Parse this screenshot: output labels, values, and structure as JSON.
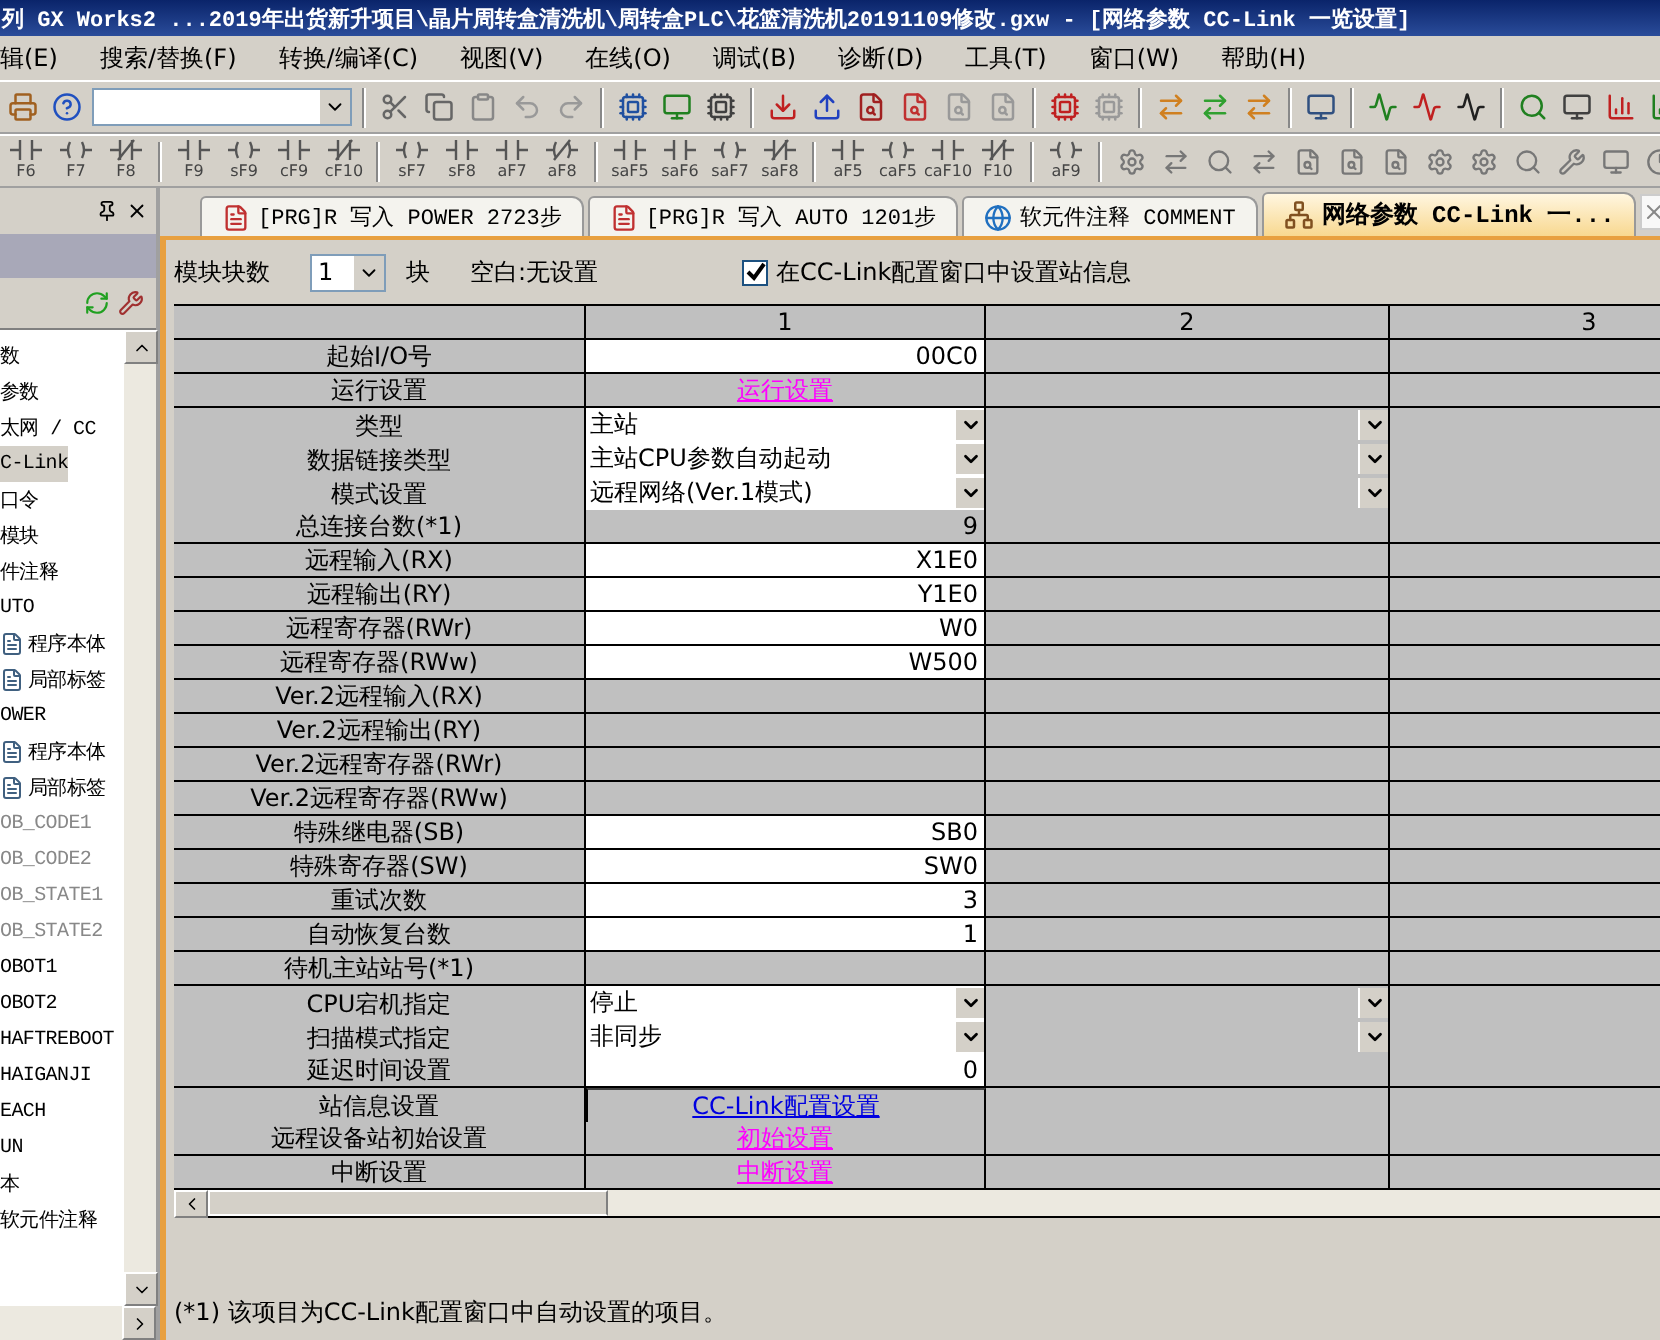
{
  "window": {
    "title": "列 GX Works2 ...2019年出货新升项目\\晶片周转盒清洗机\\周转盒PLC\\花篮清洗机20191109修改.gxw - [网络参数  CC-Link 一览设置]"
  },
  "menu": [
    "辑(E)",
    "搜索/替换(F)",
    "转换/编译(C)",
    "视图(V)",
    "在线(O)",
    "调试(B)",
    "诊断(D)",
    "工具(T)",
    "窗口(W)",
    "帮助(H)"
  ],
  "function_keys": [
    "F6",
    "F7",
    "F8",
    "F9",
    "sF9",
    "cF9",
    "cF10",
    "sF7",
    "sF8",
    "aF7",
    "aF8",
    "saF5",
    "saF6",
    "saF7",
    "saF8",
    "aF5",
    "caF5",
    "caF10",
    "F10",
    "aF9"
  ],
  "sidebar": {
    "items": [
      {
        "label": "数",
        "kind": "text",
        "selected": false,
        "dimmed": false
      },
      {
        "label": "参数",
        "kind": "text",
        "selected": false,
        "dimmed": false
      },
      {
        "label": "太网 / CC",
        "kind": "text",
        "selected": false,
        "dimmed": false
      },
      {
        "label": "C-Link",
        "kind": "text",
        "selected": true,
        "dimmed": false
      },
      {
        "label": "口令",
        "kind": "text",
        "selected": false,
        "dimmed": false
      },
      {
        "label": "模块",
        "kind": "text",
        "selected": false,
        "dimmed": false
      },
      {
        "label": "件注释",
        "kind": "text",
        "selected": false,
        "dimmed": false
      },
      {
        "label": "UTO",
        "kind": "text",
        "selected": false,
        "dimmed": false
      },
      {
        "label": "程序本体",
        "kind": "file",
        "selected": false,
        "dimmed": false
      },
      {
        "label": "局部标签",
        "kind": "file",
        "selected": false,
        "dimmed": false
      },
      {
        "label": "OWER",
        "kind": "text",
        "selected": false,
        "dimmed": false
      },
      {
        "label": "程序本体",
        "kind": "file",
        "selected": false,
        "dimmed": false
      },
      {
        "label": "局部标签",
        "kind": "file",
        "selected": false,
        "dimmed": false
      },
      {
        "label": "OB_CODE1",
        "kind": "text",
        "selected": false,
        "dimmed": true
      },
      {
        "label": "OB_CODE2",
        "kind": "text",
        "selected": false,
        "dimmed": true
      },
      {
        "label": "OB_STATE1",
        "kind": "text",
        "selected": false,
        "dimmed": true
      },
      {
        "label": "OB_STATE2",
        "kind": "text",
        "selected": false,
        "dimmed": true
      },
      {
        "label": "OBOT1",
        "kind": "text",
        "selected": false,
        "dimmed": false
      },
      {
        "label": "OBOT2",
        "kind": "text",
        "selected": false,
        "dimmed": false
      },
      {
        "label": "HAFTREBOOT",
        "kind": "text",
        "selected": false,
        "dimmed": false
      },
      {
        "label": "HAIGANJI",
        "kind": "text",
        "selected": false,
        "dimmed": false
      },
      {
        "label": "EACH",
        "kind": "text",
        "selected": false,
        "dimmed": false
      },
      {
        "label": "UN",
        "kind": "text",
        "selected": false,
        "dimmed": false
      },
      {
        "label": "本",
        "kind": "text",
        "selected": false,
        "dimmed": false
      },
      {
        "label": "软元件注释",
        "kind": "text",
        "selected": false,
        "dimmed": false
      }
    ]
  },
  "tabs": [
    {
      "label": "[PRG]R 写入 POWER 2723步",
      "kind": "program",
      "selected": false
    },
    {
      "label": "[PRG]R 写入 AUTO 1201步",
      "kind": "program",
      "selected": false
    },
    {
      "label": "软元件注释 COMMENT",
      "kind": "comment",
      "selected": false
    },
    {
      "label": "网络参数  CC-Link 一...",
      "kind": "network",
      "selected": true
    }
  ],
  "options": {
    "module_count_label": "模块块数",
    "module_count": "1",
    "unit": "块",
    "blank_note": "空白:无设置",
    "station_checkbox": {
      "label": "在CC-Link配置窗口中设置站信息",
      "checked": true
    }
  },
  "table": {
    "columns": [
      "1",
      "2",
      "3"
    ],
    "rows": [
      {
        "label": "起始I/O号",
        "kind": "input",
        "value": "00C0",
        "col2_dropdown": false
      },
      {
        "label": "运行设置",
        "kind": "link",
        "value": "运行设置",
        "col2_dropdown": false
      },
      {
        "label": "类型",
        "kind": "select",
        "value": "主站",
        "col2_dropdown": true
      },
      {
        "label": "数据链接类型",
        "kind": "select",
        "value": "主站CPU参数自动起动",
        "col2_dropdown": true
      },
      {
        "label": "模式设置",
        "kind": "select",
        "value": "远程网络(Ver.1模式)",
        "col2_dropdown": true
      },
      {
        "label": "总连接台数(*1)",
        "kind": "readonly",
        "value": "9",
        "col2_dropdown": false
      },
      {
        "label": "远程输入(RX)",
        "kind": "input",
        "value": "X1E0",
        "col2_dropdown": false
      },
      {
        "label": "远程输出(RY)",
        "kind": "input",
        "value": "Y1E0",
        "col2_dropdown": false
      },
      {
        "label": "远程寄存器(RWr)",
        "kind": "input",
        "value": "W0",
        "col2_dropdown": false
      },
      {
        "label": "远程寄存器(RWw)",
        "kind": "input",
        "value": "W500",
        "col2_dropdown": false
      },
      {
        "label": "Ver.2远程输入(RX)",
        "kind": "empty",
        "col2_dropdown": false
      },
      {
        "label": "Ver.2远程输出(RY)",
        "kind": "empty",
        "col2_dropdown": false
      },
      {
        "label": "Ver.2远程寄存器(RWr)",
        "kind": "empty",
        "col2_dropdown": false
      },
      {
        "label": "Ver.2远程寄存器(RWw)",
        "kind": "empty",
        "col2_dropdown": false
      },
      {
        "label": "特殊继电器(SB)",
        "kind": "input",
        "value": "SB0",
        "col2_dropdown": false
      },
      {
        "label": "特殊寄存器(SW)",
        "kind": "input",
        "value": "SW0",
        "col2_dropdown": false
      },
      {
        "label": "重试次数",
        "kind": "input",
        "value": "3",
        "col2_dropdown": false
      },
      {
        "label": "自动恢复台数",
        "kind": "input",
        "value": "1",
        "col2_dropdown": false
      },
      {
        "label": "待机主站站号(*1)",
        "kind": "empty",
        "col2_dropdown": false
      },
      {
        "label": "CPU宕机指定",
        "kind": "select",
        "value": "停止",
        "col2_dropdown": true
      },
      {
        "label": "扫描模式指定",
        "kind": "select",
        "value": "非同步",
        "col2_dropdown": true
      },
      {
        "label": "延迟时间设置",
        "kind": "input",
        "value": "0",
        "col2_dropdown": false
      },
      {
        "label": "站信息设置",
        "kind": "button",
        "value": "CC-Link配置设置",
        "col2_dropdown": false
      },
      {
        "label": "远程设备站初始设置",
        "kind": "link",
        "value": "初始设置",
        "col2_dropdown": false
      },
      {
        "label": "中断设置",
        "kind": "link",
        "value": "中断设置",
        "col2_dropdown": false
      }
    ]
  },
  "footnote": "(*1) 该项目为CC-Link配置窗口中自动设置的项目。"
}
